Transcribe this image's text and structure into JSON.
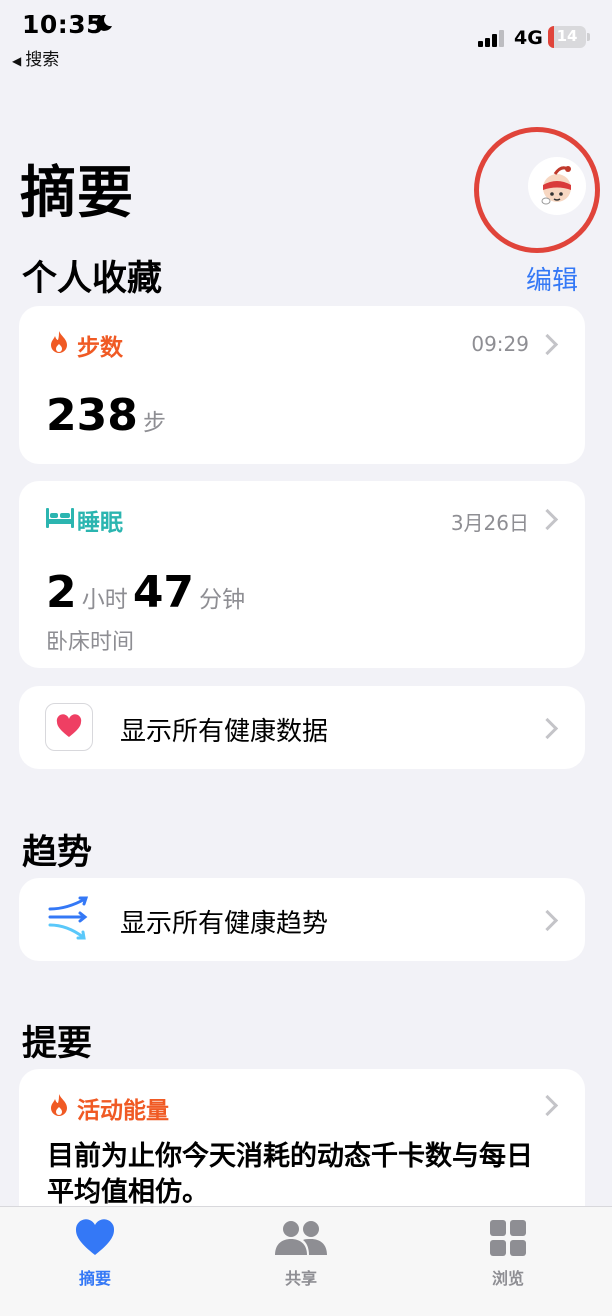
{
  "status_bar": {
    "time": "10:35",
    "back_label": "搜索",
    "network": "4G",
    "battery": "14"
  },
  "header": {
    "title": "摘要"
  },
  "favorites": {
    "section_title": "个人收藏",
    "edit_label": "编辑",
    "steps": {
      "label": "步数",
      "time": "09:29",
      "value": "238",
      "unit": "步"
    },
    "sleep": {
      "label": "睡眠",
      "date": "3月26日",
      "hours": "2",
      "hours_unit": "小时",
      "minutes": "47",
      "minutes_unit": "分钟",
      "caption": "卧床时间"
    },
    "show_all_label": "显示所有健康数据"
  },
  "trends": {
    "section_title": "趋势",
    "show_all_label": "显示所有健康趋势"
  },
  "highlights": {
    "section_title": "提要",
    "activity": {
      "label": "活动能量",
      "text": "目前为止你今天消耗的动态千卡数与每日平均值相仿。"
    }
  },
  "tab_bar": {
    "items": [
      {
        "label": "摘要",
        "active": true
      },
      {
        "label": "共享"
      },
      {
        "label": "浏览"
      }
    ]
  },
  "colors": {
    "accent": "#3478f6",
    "steps": "#f05a24",
    "sleep": "#2bb5b0",
    "highlight_ring": "#e0443a"
  }
}
